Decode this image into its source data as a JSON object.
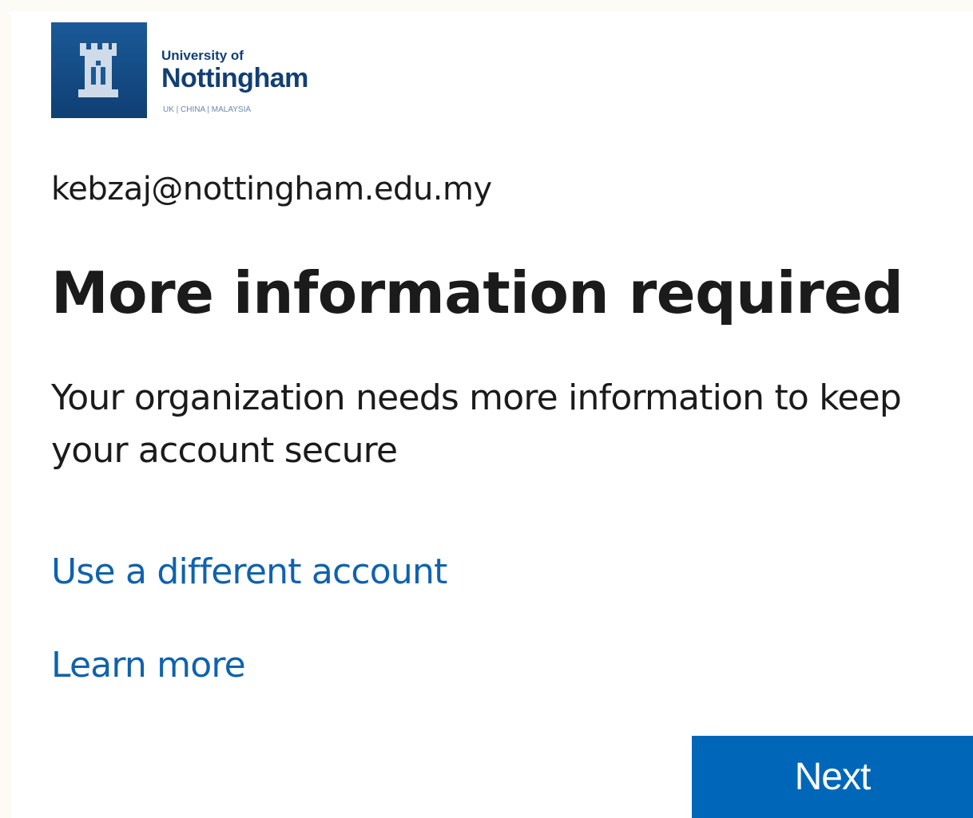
{
  "logo": {
    "line1": "University of",
    "line2": "Nottingham",
    "line3": "UK | CHINA | MALAYSIA",
    "icon": "castle-crest-icon",
    "background_color": "#0f3f74"
  },
  "account": {
    "email": "kebzaj@nottingham.edu.my"
  },
  "page": {
    "title": "More information required",
    "description": "Your organization needs more information to keep your account secure"
  },
  "links": {
    "different_account": "Use a different account",
    "learn_more": "Learn more",
    "link_color": "#0f62ae"
  },
  "actions": {
    "next_label": "Next",
    "primary_color": "#0067b8"
  }
}
